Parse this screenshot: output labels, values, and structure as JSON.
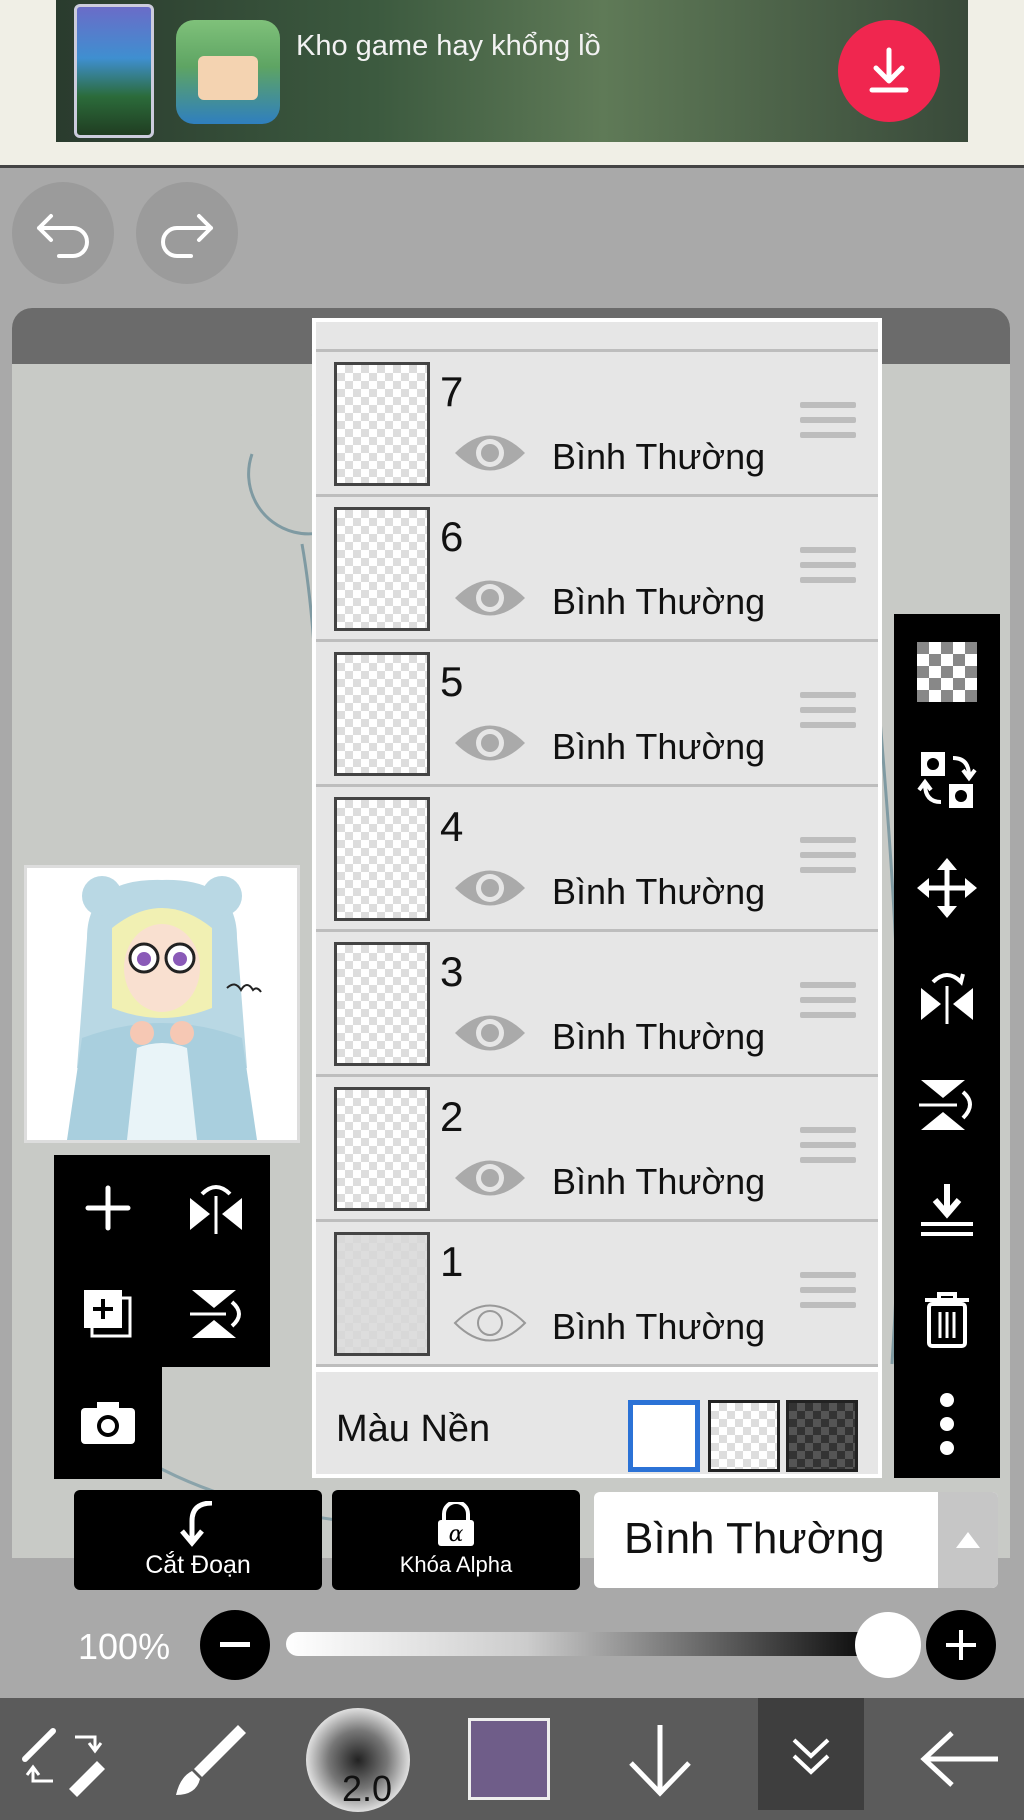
{
  "ad": {
    "text": "Kho game hay khổng lồ",
    "download_icon": "download-icon",
    "accent": "#f0264f"
  },
  "toolbar": {
    "undo_icon": "undo-icon",
    "redo_icon": "redo-icon"
  },
  "layers": [
    {
      "number": "7",
      "blend": "Bình Thường",
      "visible": true
    },
    {
      "number": "6",
      "blend": "Bình Thường",
      "visible": true
    },
    {
      "number": "5",
      "blend": "Bình Thường",
      "visible": true
    },
    {
      "number": "4",
      "blend": "Bình Thường",
      "visible": true
    },
    {
      "number": "3",
      "blend": "Bình Thường",
      "visible": true
    },
    {
      "number": "2",
      "blend": "Bình Thường",
      "visible": true
    },
    {
      "number": "1",
      "blend": "Bình Thường",
      "visible": false
    }
  ],
  "background": {
    "label": "Màu Nền",
    "options": [
      "white",
      "transparent",
      "dark-checker"
    ],
    "selected": "white"
  },
  "actions": {
    "clip_label": "Cắt Đoạn",
    "alpha_lock_label": "Khóa Alpha",
    "blend_mode_value": "Bình Thường"
  },
  "opacity": {
    "label": "100%",
    "value": 1.0
  },
  "bottom_bar": {
    "brush_size": "2.0",
    "current_color": "#6f5d89"
  },
  "colors": {
    "panel_bg": "#e6e6e6",
    "selection_blue": "#2b72d6",
    "toolbar_black": "#000000"
  }
}
